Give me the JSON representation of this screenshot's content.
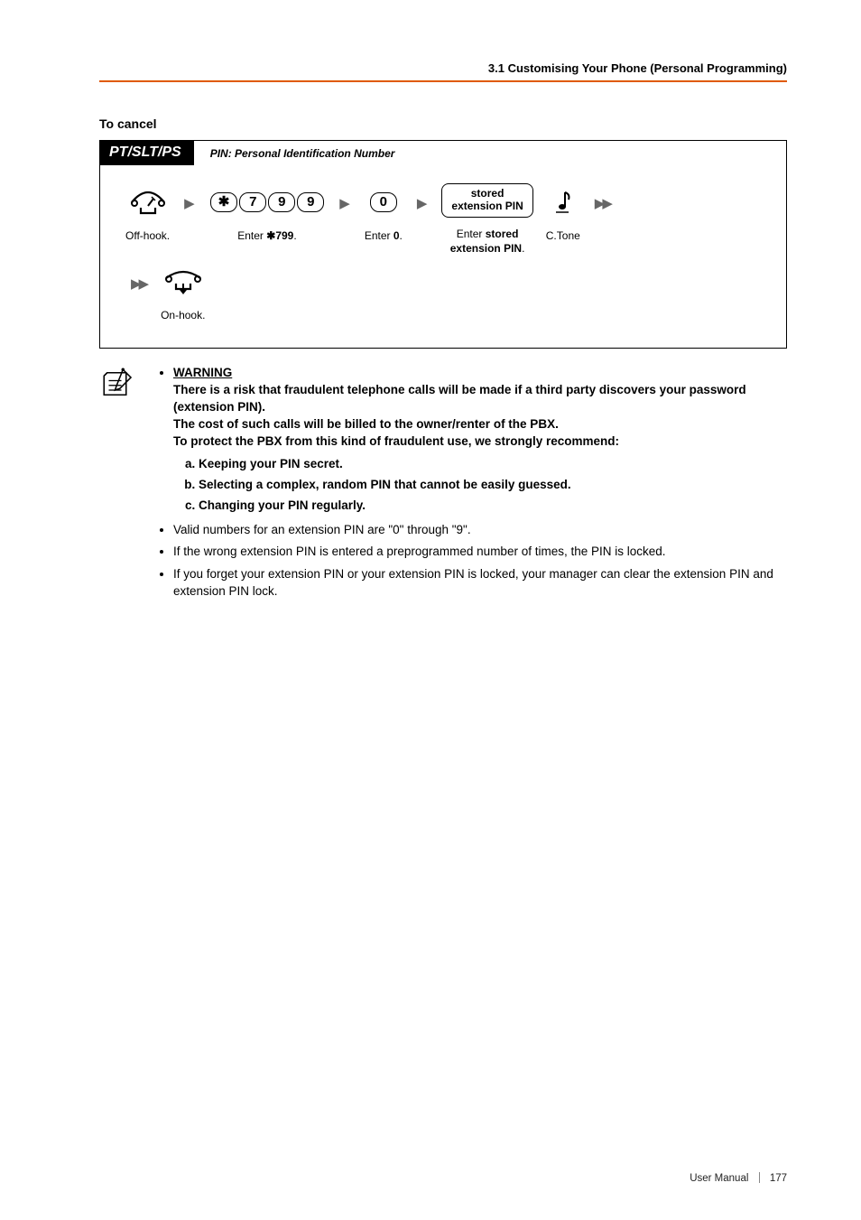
{
  "header": "3.1 Customising Your Phone (Personal Programming)",
  "subtitle": "To cancel",
  "flow": {
    "tab": "PT/SLT/PS",
    "caption": "PIN: Personal Identification Number",
    "steps": {
      "offhook": "Off-hook.",
      "enter799_pre": "Enter ",
      "enter799_key": "799",
      "enter0_pre": "Enter ",
      "enter0_key": "0",
      "pinbox_l1": "stored",
      "pinbox_l2": "extension PIN",
      "enterpin_pre": "Enter ",
      "enterpin_b1": "stored",
      "enterpin_b2": "extension PIN",
      "ctone": "C.Tone",
      "onhook": "On-hook."
    },
    "keys": {
      "star": "✱",
      "k7": "7",
      "k9a": "9",
      "k9b": "9",
      "k0": "0"
    }
  },
  "notes": {
    "warning_title": "WARNING",
    "warning_p1": "There is a risk that fraudulent telephone calls will be made if a third party discovers your password (extension PIN).",
    "warning_p2": "The cost of such calls will be billed to the owner/renter of the PBX.",
    "warning_p3": "To protect the PBX from this kind of fraudulent use, we strongly recommend:",
    "rec_a": "Keeping your PIN secret.",
    "rec_b": "Selecting a complex, random PIN that cannot be easily guessed.",
    "rec_c": "Changing your PIN regularly.",
    "bullet_valid": "Valid numbers for an extension PIN are \"0\" through \"9\".",
    "bullet_locked": "If the wrong extension PIN is entered a preprogrammed number of times, the PIN is locked.",
    "bullet_forget": "If you forget your extension PIN or your extension PIN is locked, your manager can clear the extension PIN and extension PIN lock."
  },
  "footer": {
    "label": "User Manual",
    "page": "177"
  }
}
